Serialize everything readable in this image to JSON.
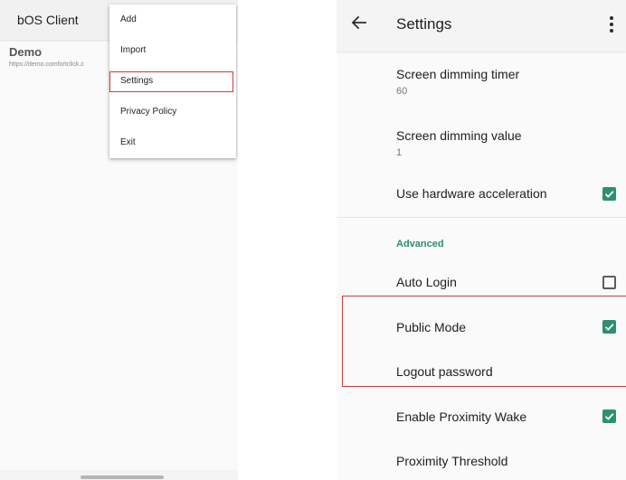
{
  "left": {
    "appbar_title": "bOS Client",
    "server": {
      "name": "Demo",
      "url": "https://demo.comfortclick.c"
    },
    "menu": [
      {
        "label": "Add"
      },
      {
        "label": "Import"
      },
      {
        "label": "Settings",
        "highlighted": true
      },
      {
        "label": "Privacy Policy"
      },
      {
        "label": "Exit"
      }
    ]
  },
  "right": {
    "appbar_title": "Settings",
    "icons": {
      "back": "arrow-back-icon",
      "more": "more-vert-icon"
    },
    "prefs": {
      "dim_timer": {
        "title": "Screen dimming timer",
        "summary": "60"
      },
      "dim_value": {
        "title": "Screen dimming value",
        "summary": "1"
      },
      "hw_accel": {
        "title": "Use hardware acceleration",
        "checked": true
      },
      "category": "Advanced",
      "auto_login": {
        "title": "Auto Login",
        "checked": false
      },
      "public_mode": {
        "title": "Public Mode",
        "checked": true
      },
      "logout_password": {
        "title": "Logout password"
      },
      "prox_wake": {
        "title": "Enable Proximity Wake",
        "checked": true
      },
      "prox_threshold": {
        "title": "Proximity Threshold"
      }
    }
  },
  "colors": {
    "accent": "#2e8f73",
    "highlight": "#d43a3a"
  }
}
